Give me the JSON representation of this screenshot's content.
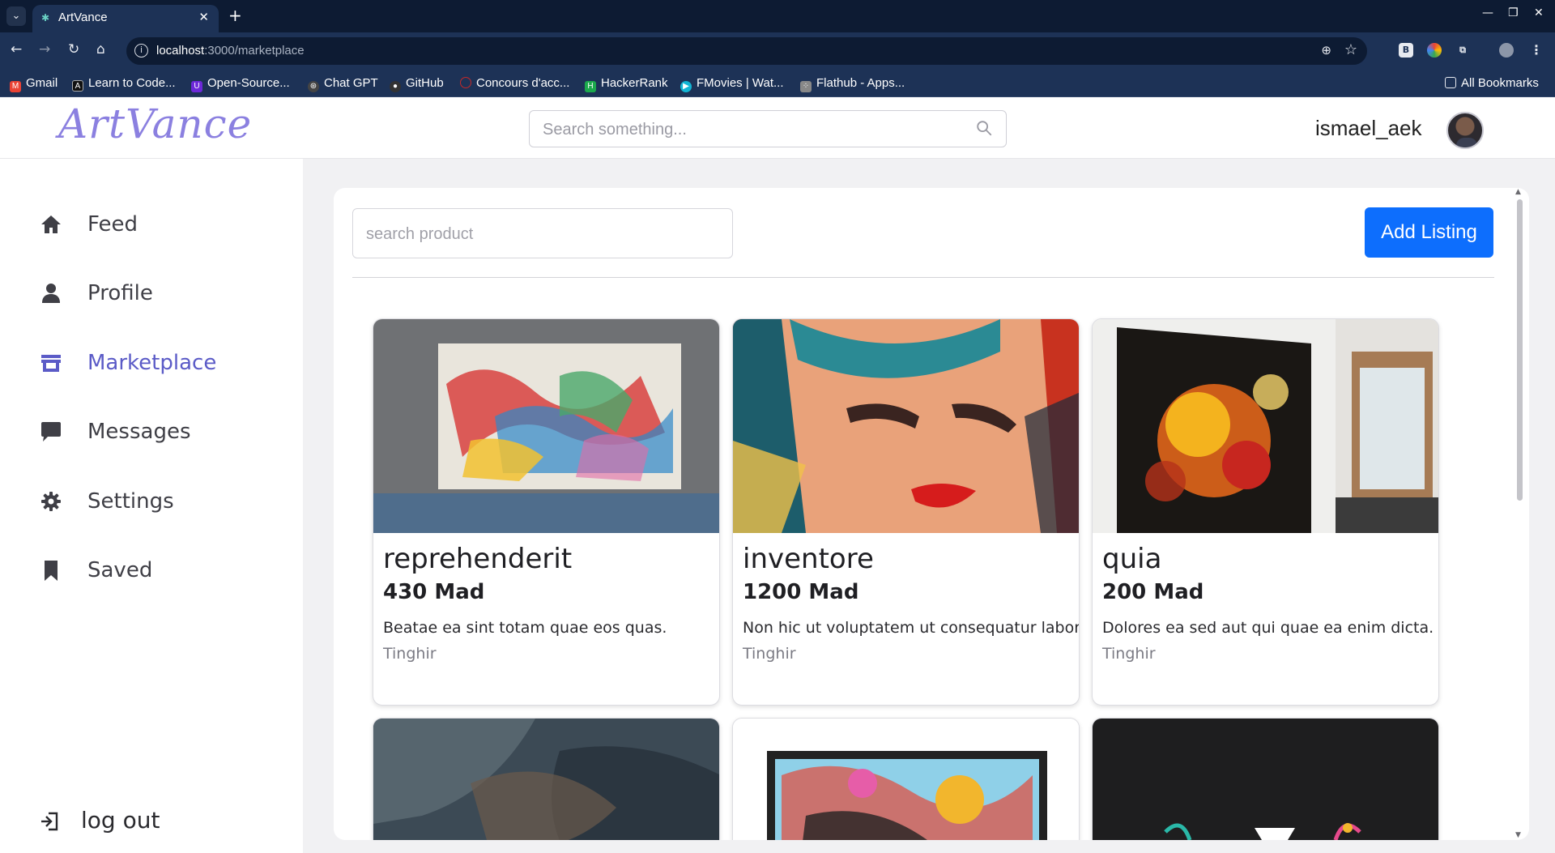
{
  "browser": {
    "tab_title": "ArtVance",
    "url_host": "localhost",
    "url_path": ":3000/marketplace",
    "bookmarks": [
      {
        "label": "Gmail",
        "color": "#ea4335"
      },
      {
        "label": "Learn to Code...",
        "color": "#111111"
      },
      {
        "label": "Open-Source...",
        "color": "#6d28d9"
      },
      {
        "label": "Chat GPT",
        "color": "#444444"
      },
      {
        "label": "GitHub",
        "color": "#333333"
      },
      {
        "label": "Concours d'acc...",
        "color": "#c62828"
      },
      {
        "label": "HackerRank",
        "color": "#1ba94c"
      },
      {
        "label": "FMovies | Wat...",
        "color": "#12b5d4"
      },
      {
        "label": "Flathub - Apps...",
        "color": "#888888"
      }
    ],
    "all_bookmarks": "All Bookmarks"
  },
  "header": {
    "logo": "ArtVance",
    "search_placeholder": "Search something...",
    "username": "ismael_aek"
  },
  "sidebar": {
    "items": [
      {
        "label": "Feed",
        "icon": "home-icon"
      },
      {
        "label": "Profile",
        "icon": "user-icon"
      },
      {
        "label": "Marketplace",
        "icon": "store-icon",
        "active": true
      },
      {
        "label": "Messages",
        "icon": "message-icon"
      },
      {
        "label": "Settings",
        "icon": "gear-icon"
      },
      {
        "label": "Saved",
        "icon": "bookmark-icon"
      }
    ],
    "logout": "log out",
    "active_color": "#5b5bc7"
  },
  "marketplace": {
    "search_placeholder": "search product",
    "add_button": "Add Listing",
    "products": [
      {
        "title": "reprehenderit",
        "price": "430 Mad",
        "description": "Beatae ea sint totam quae eos quas.",
        "location": "Tinghir"
      },
      {
        "title": "inventore",
        "price": "1200 Mad",
        "description": "Non hic ut voluptatem ut consequatur labor",
        "location": "Tinghir"
      },
      {
        "title": "quia",
        "price": "200 Mad",
        "description": "Dolores ea sed aut qui quae ea enim dicta.",
        "location": "Tinghir"
      },
      {
        "title": "",
        "price": "",
        "description": "",
        "location": ""
      },
      {
        "title": "",
        "price": "",
        "description": "",
        "location": ""
      },
      {
        "title": "",
        "price": "",
        "description": "",
        "location": ""
      }
    ]
  },
  "colors": {
    "primary_button": "#0d6efd",
    "brand": "#8b80e0"
  }
}
